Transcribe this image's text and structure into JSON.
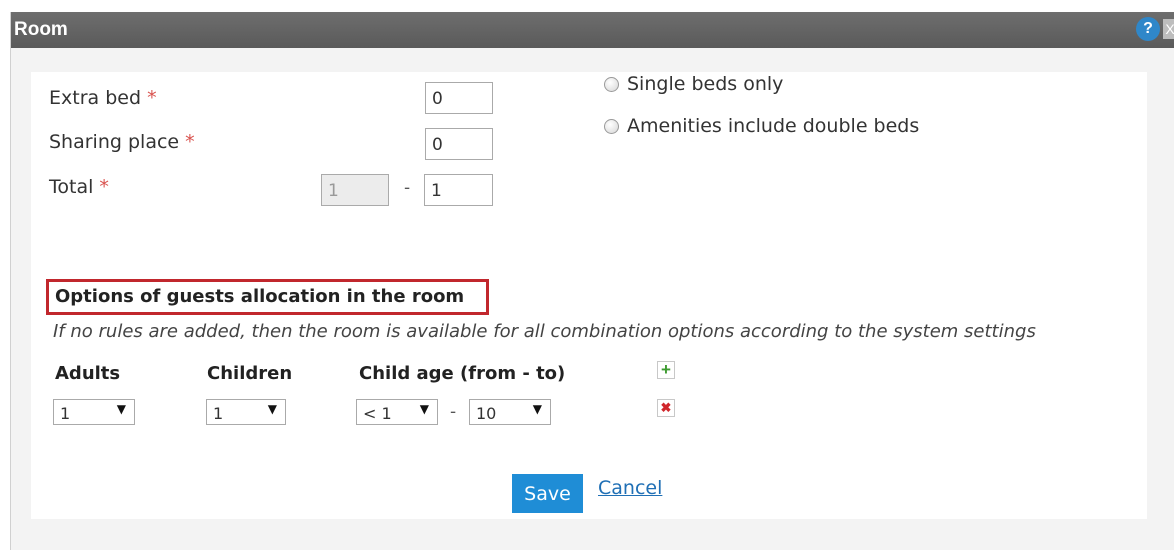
{
  "dialog": {
    "title": "Room",
    "help_label": "?",
    "close_label": "X"
  },
  "fields": {
    "extra_bed": {
      "label": "Extra bed",
      "required_mark": "*",
      "value": "0"
    },
    "sharing_place": {
      "label": "Sharing place",
      "required_mark": "*",
      "value": "0"
    },
    "total": {
      "label": "Total",
      "required_mark": "*",
      "value_from": "1",
      "separator": "-",
      "value_to": "1"
    }
  },
  "bed_options": [
    {
      "label": "Single beds only",
      "checked": false
    },
    {
      "label": "Amenities include double beds",
      "checked": false
    }
  ],
  "allocation": {
    "title": "Options of guests allocation in the room",
    "hint": "If no rules are added, then the room is available for all combination options according to the system settings",
    "columns": {
      "adults": "Adults",
      "children": "Children",
      "child_age": "Child age (from - to)"
    },
    "row": {
      "adults": "1",
      "children": "1",
      "age_from": "< 1",
      "age_separator": "-",
      "age_to": "10"
    },
    "add_icon": "plus-icon",
    "remove_icon": "x-icon",
    "add_glyph": "+",
    "remove_glyph": "✖"
  },
  "footer": {
    "save_label": "Save",
    "cancel_label": "Cancel"
  },
  "colors": {
    "titlebar": "#5f5f5f",
    "accent": "#1f8dd6",
    "highlight_border": "#c1272d",
    "required": "#d9534f",
    "add": "#3c9a2f",
    "remove": "#d0262b"
  }
}
